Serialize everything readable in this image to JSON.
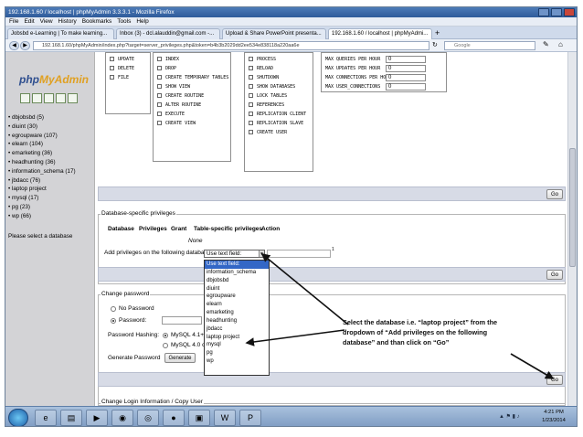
{
  "window": {
    "title": "192.168.1.60 / localhost | phpMyAdmin 3.3.3.1 - Mozilla Firefox"
  },
  "menu": [
    "File",
    "Edit",
    "View",
    "History",
    "Bookmarks",
    "Tools",
    "Help"
  ],
  "tabs": [
    {
      "label": "Jobsbd e-Learning | To make learning...",
      "icon": "page-icon"
    },
    {
      "label": "Inbox (3) - dcl.alauddin@gmail.com -...",
      "icon": "gmail-icon"
    },
    {
      "label": "Upload & Share PowerPoint presenta...",
      "icon": "slideshare-icon"
    },
    {
      "label": "192.168.1.60 / localhost | phpMyAdmi...",
      "icon": "phpmyadmin-icon"
    }
  ],
  "nav": {
    "url": "192.168.1.60/phpMyAdmin/index.php?target=server_privileges.php&token=b4b3b2029dd2ee534e838118a220aa6e",
    "search_placeholder": "Google",
    "newtab": "+"
  },
  "sidebar": {
    "logo_php": "php",
    "logo_my": "MyAdmin",
    "databases": [
      "dbjobsbd (5)",
      "diuint (30)",
      "egroupware (107)",
      "elearn (104)",
      "emarketing (36)",
      "headhunting (36)",
      "information_schema (17)",
      "jbdacc (76)",
      "laptop project",
      "mysql (17)",
      "pg (23)",
      "wp (66)"
    ],
    "note": "Please select a database"
  },
  "global_privs": {
    "col1": [
      "UPDATE",
      "DELETE",
      "FILE"
    ],
    "col2": [
      "INDEX",
      "DROP",
      "CREATE TEMPORARY TABLES",
      "SHOW VIEW",
      "CREATE ROUTINE",
      "ALTER ROUTINE",
      "EXECUTE",
      "CREATE VIEW"
    ],
    "col3": [
      "PROCESS",
      "RELOAD",
      "SHUTDOWN",
      "SHOW DATABASES",
      "LOCK TABLES",
      "REFERENCES",
      "REPLICATION CLIENT",
      "REPLICATION SLAVE",
      "CREATE USER"
    ],
    "limits": [
      {
        "label": "MAX QUERIES PER HOUR",
        "value": "0"
      },
      {
        "label": "MAX UPDATES PER HOUR",
        "value": "0"
      },
      {
        "label": "MAX CONNECTIONS PER HOUR",
        "value": "0"
      },
      {
        "label": "MAX USER_CONNECTIONS",
        "value": "0"
      }
    ]
  },
  "buttons": {
    "go": "Go",
    "generate": "Generate"
  },
  "db_privs": {
    "legend": "Database-specific privileges",
    "headers": [
      "Database",
      "Privileges",
      "Grant",
      "Table-specific privileges",
      "Action"
    ],
    "none": "None",
    "add_label": "Add privileges on the following database:",
    "selected": "Use text field:",
    "options": [
      "Use text field:",
      "information_schema",
      "dbjobsbd",
      "diuint",
      "egroupware",
      "elearn",
      "emarketing",
      "headhunting",
      "jbdacc",
      "laptop project",
      "mysql",
      "pg",
      "wp"
    ],
    "footnote": "1"
  },
  "change_password": {
    "legend": "Change password",
    "no_password": "No Password",
    "password": "Password:",
    "hashing_label": "Password Hashing:",
    "hash_opt1": "MySQL 4.1+",
    "hash_opt2": "MySQL 4.0 c",
    "generate_label": "Generate Password"
  },
  "login_info": {
    "legend": "Change Login Information / Copy User"
  },
  "callout": "Select the database i.e. “laptop project” from the dropdown of “Add privileges on the following database” and than click on “Go”",
  "taskbar": {
    "time": "4:21 PM",
    "date": "1/23/2014"
  },
  "colors": {
    "accent": "#3367c6",
    "sidebar": "#d3d3d6",
    "gobar": "#d7dbe6"
  }
}
